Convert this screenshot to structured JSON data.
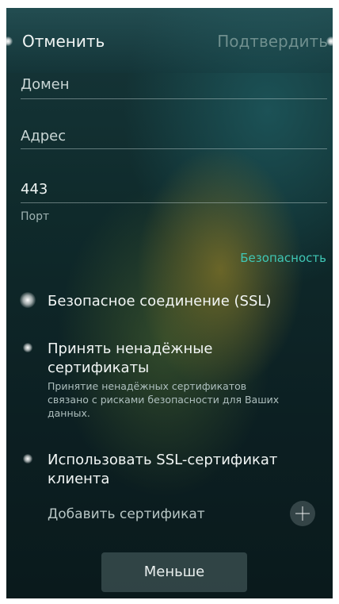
{
  "header": {
    "cancel_label": "Отменить",
    "confirm_label": "Подтвердить"
  },
  "form": {
    "domain_placeholder": "Домен",
    "address_placeholder": "Адрес",
    "port_value": "443",
    "port_label": "Порт"
  },
  "security": {
    "section_label": "Безопасность",
    "ssl_label": "Безопасное соединение (SSL)",
    "accept_untrusted_label": "Принять ненадёжные сертификаты",
    "accept_untrusted_description": "Принятие ненадёжных сертификатов связано с рисками безопасности для Ваших данных.",
    "client_cert_label": "Использовать SSL-сертификат клиента",
    "add_certificate_label": "Добавить сертификат"
  },
  "footer": {
    "less_label": "Меньше"
  },
  "icons": {
    "add_certificate": "plus-icon",
    "toggle": "switch-dot-icon"
  },
  "colors": {
    "accent": "#3fc7b5"
  }
}
